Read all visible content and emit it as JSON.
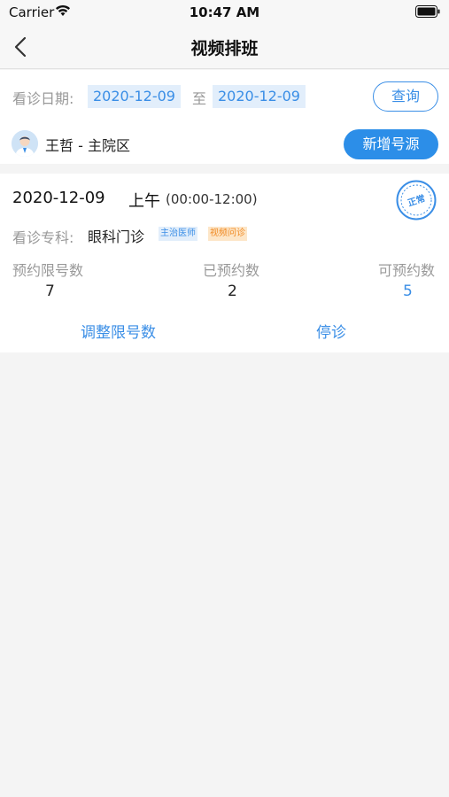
{
  "status_bar": {
    "carrier": "Carrier",
    "time": "10:47 AM"
  },
  "nav": {
    "title": "视频排班"
  },
  "filter": {
    "date_label": "看诊日期:",
    "start_date": "2020-12-09",
    "separator": "至",
    "end_date": "2020-12-09",
    "query_label": "查询"
  },
  "doctor": {
    "name_area": "王哲 - 主院区",
    "add_button": "新增号源"
  },
  "schedule": {
    "date": "2020-12-09",
    "period": "上午",
    "time_range": "(00:00-12:00)",
    "status_stamp": "正常",
    "dept_label": "看诊专科:",
    "dept_value": "眼科门诊",
    "tag_title": "主治医师",
    "tag_video": "视频问诊",
    "stats": {
      "limit_label": "预约限号数",
      "limit_value": "7",
      "booked_label": "已预约数",
      "booked_value": "2",
      "available_label": "可预约数",
      "available_value": "5"
    },
    "actions": {
      "adjust": "调整限号数",
      "stop": "停诊"
    }
  },
  "colors": {
    "accent": "#3a8ee6",
    "button_fill": "#2c8ee8",
    "tag_orange": "#f08a24"
  }
}
